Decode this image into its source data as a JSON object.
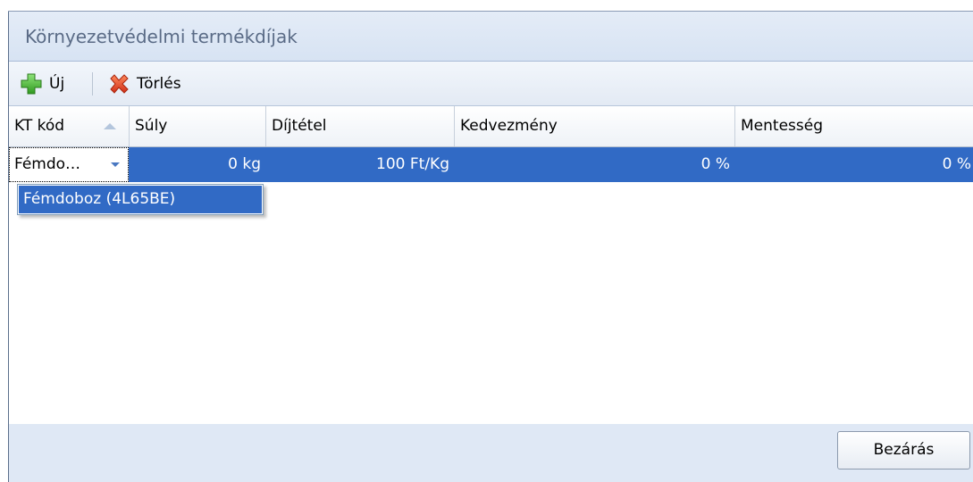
{
  "window": {
    "title": "Környezetvédelmi termékdíjak"
  },
  "toolbar": {
    "new_label": "Új",
    "new_icon": "add-icon",
    "delete_label": "Törlés",
    "delete_icon": "delete-icon"
  },
  "grid": {
    "columns": [
      "KT kód",
      "Súly",
      "Díjtétel",
      "Kedvezmény",
      "Mentesség"
    ],
    "sort_column": "KT kód",
    "sort_direction": "ascending",
    "rows": [
      {
        "kt_kod": "Fémdo…",
        "suly": "0 kg",
        "dijtetel": "100 Ft/Kg",
        "kedvezmeny": "0 %",
        "mentesseg": "0 %"
      }
    ],
    "dropdown_options": [
      "Fémdoboz (4L65BE)"
    ]
  },
  "footer": {
    "close_label": "Bezárás"
  },
  "colors": {
    "selection": "#316ac5",
    "title_text": "#5a6b86",
    "footer_bg": "#dfe8f5"
  }
}
